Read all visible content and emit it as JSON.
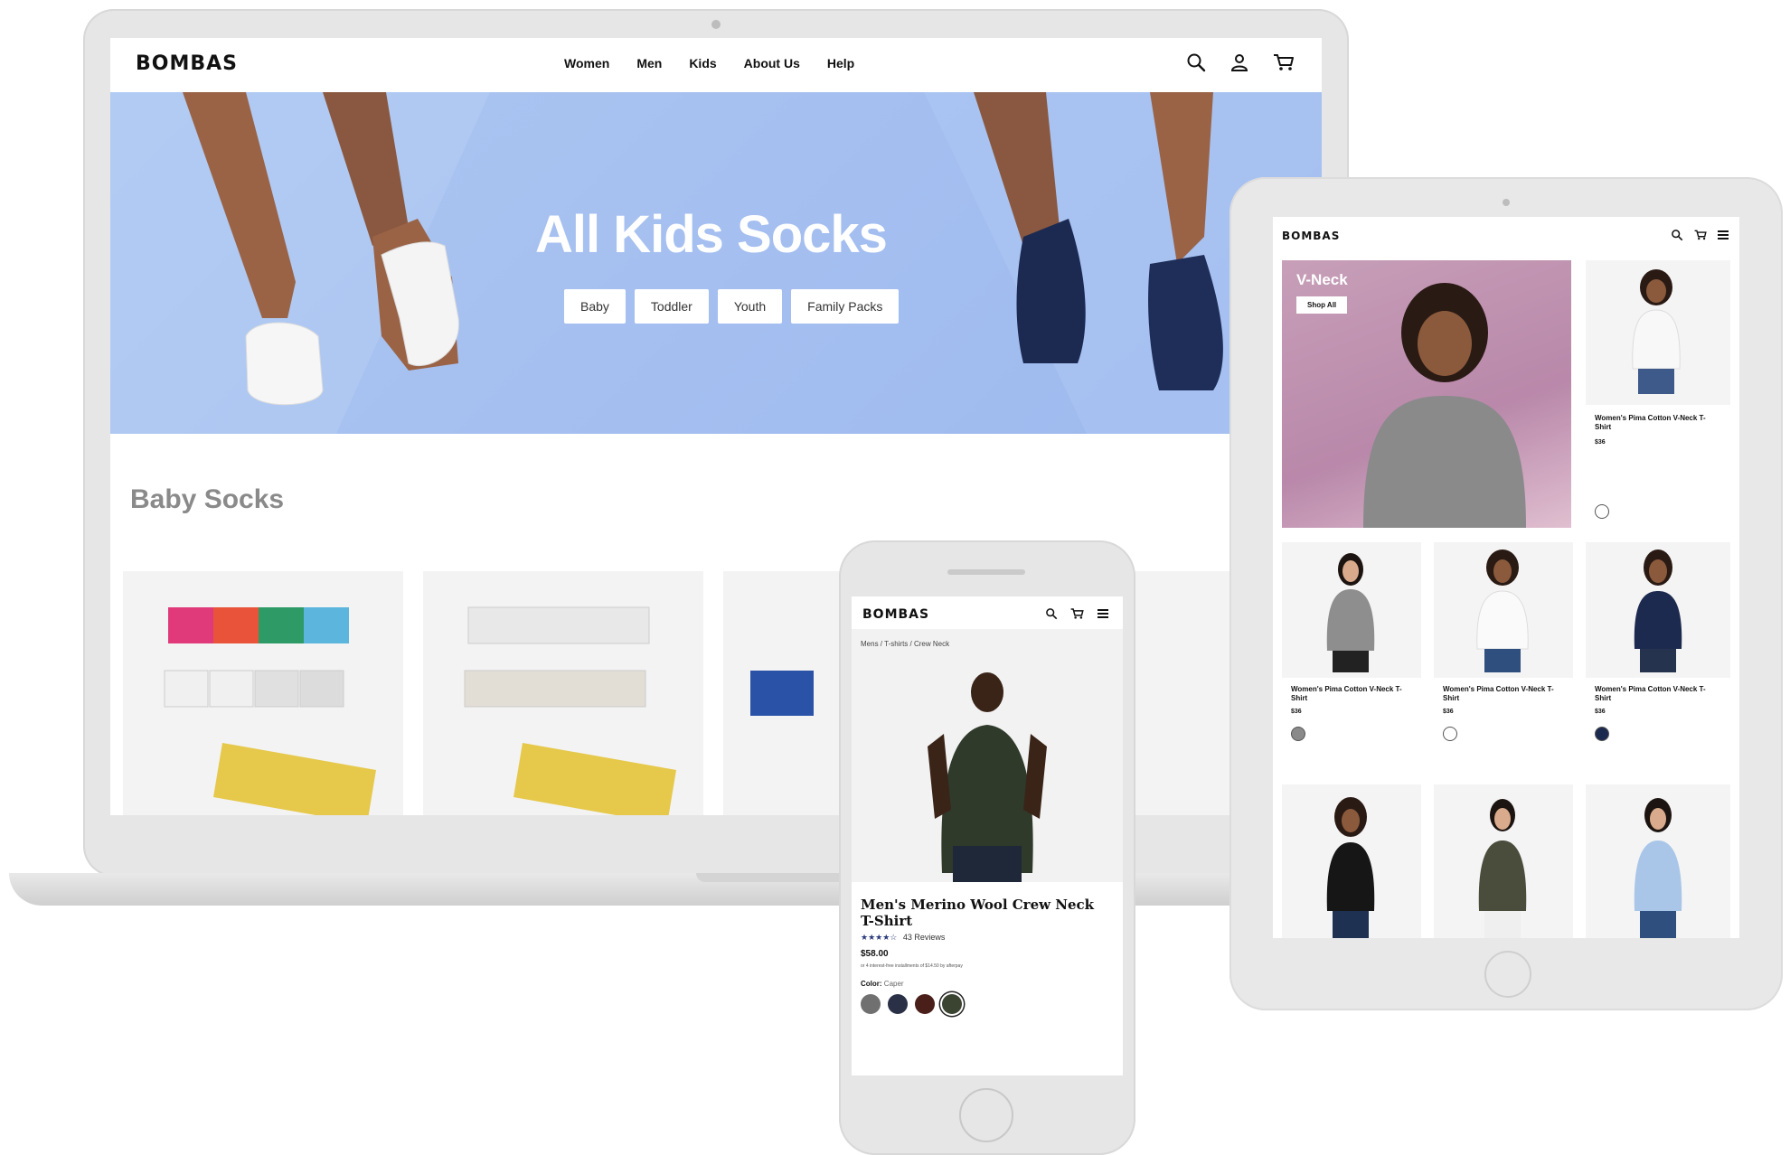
{
  "laptop": {
    "logo": "BOMBAS",
    "nav": [
      "Women",
      "Men",
      "Kids",
      "About Us",
      "Help"
    ],
    "icons": [
      "search-icon",
      "account-icon",
      "cart-icon"
    ],
    "hero_title": "All Kids Socks",
    "hero_buttons": [
      "Baby",
      "Toddler",
      "Youth",
      "Family Packs"
    ],
    "section_title": "Baby Socks"
  },
  "tablet": {
    "logo": "BOMBAS",
    "icons": [
      "search-icon",
      "cart-icon",
      "menu-icon"
    ],
    "banner_title": "V-Neck",
    "banner_button": "Shop All",
    "products": [
      {
        "name": "Women's Pima Cotton V-Neck T-Shirt",
        "price": "$36",
        "swatch": "#ffffff"
      },
      {
        "name": "Women's Pima Cotton V-Neck T-Shirt",
        "price": "$36",
        "swatch": "#8a8a8a"
      },
      {
        "name": "Women's Pima Cotton V-Neck T-Shirt",
        "price": "$36",
        "swatch": "#ffffff"
      },
      {
        "name": "Women's Pima Cotton V-Neck T-Shirt",
        "price": "$36",
        "swatch": "#1d2a4f"
      }
    ]
  },
  "phone": {
    "logo": "BOMBAS",
    "icons": [
      "search-icon",
      "cart-icon",
      "menu-icon"
    ],
    "breadcrumb": "Mens / T-shirts / Crew Neck",
    "product_title": "Men's Merino Wool Crew Neck T-Shirt",
    "stars": "★★★★☆",
    "reviews": "43 Reviews",
    "price": "$58.00",
    "installments": "or 4 interest-free installments of $14.50 by afterpay",
    "color_label": "Color:",
    "color_value": "Caper",
    "colors": [
      "#707070",
      "#2a3147",
      "#4a1f1a",
      "#3b4331"
    ]
  }
}
